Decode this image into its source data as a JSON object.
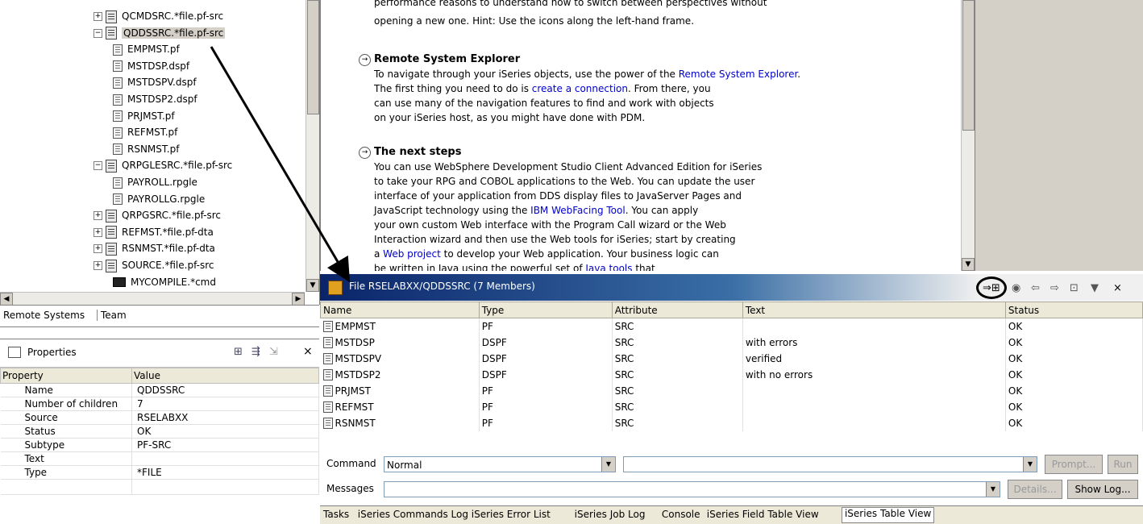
{
  "tree": {
    "nodes": [
      {
        "label": "QCMDSRC.*file.pf-src",
        "toggle": "+",
        "kind": "lib"
      },
      {
        "label": "QDDSSRC.*file.pf-src",
        "toggle": "−",
        "kind": "lib"
      },
      {
        "label": "EMPMST.pf",
        "kind": "mem"
      },
      {
        "label": "MSTDSP.dspf",
        "kind": "mem"
      },
      {
        "label": "MSTDSPV.dspf",
        "kind": "mem"
      },
      {
        "label": "MSTDSP2.dspf",
        "kind": "mem"
      },
      {
        "label": "PRJMST.pf",
        "kind": "mem"
      },
      {
        "label": "REFMST.pf",
        "kind": "mem"
      },
      {
        "label": "RSNMST.pf",
        "kind": "mem"
      },
      {
        "label": "QRPGLESRC.*file.pf-src",
        "toggle": "−",
        "kind": "lib"
      },
      {
        "label": "PAYROLL.rpgle",
        "kind": "mem"
      },
      {
        "label": "PAYROLLG.rpgle",
        "kind": "mem"
      },
      {
        "label": "QRPGSRC.*file.pf-src",
        "toggle": "+",
        "kind": "lib"
      },
      {
        "label": "REFMST.*file.pf-dta",
        "toggle": "+",
        "kind": "lib"
      },
      {
        "label": "RSNMST.*file.pf-dta",
        "toggle": "+",
        "kind": "lib"
      },
      {
        "label": "SOURCE.*file.pf-src",
        "toggle": "+",
        "kind": "lib"
      },
      {
        "label": "MYCOMPILE.*cmd",
        "kind": "cmd"
      }
    ]
  },
  "view_tabs": {
    "remote_systems": "Remote Systems",
    "team": "Team"
  },
  "properties": {
    "title": "Properties",
    "col_property": "Property",
    "col_value": "Value",
    "rows": [
      {
        "p": "Name",
        "v": "QDDSSRC"
      },
      {
        "p": "Number of children",
        "v": "7"
      },
      {
        "p": "Source",
        "v": "RSELABXX"
      },
      {
        "p": "Status",
        "v": "OK"
      },
      {
        "p": "Subtype",
        "v": "PF-SRC"
      },
      {
        "p": "Text",
        "v": ""
      },
      {
        "p": "Type",
        "v": "*FILE"
      }
    ]
  },
  "welcome": {
    "top_line1": "performance reasons to understand how to switch between perspectives without",
    "top_line2": "opening a new one. Hint: Use the icons along the left-hand frame.",
    "rse_title": "Remote System Explorer",
    "rse_l1a": "To navigate through your iSeries objects, use the power of the ",
    "rse_l1_link": "Remote System Explorer",
    "rse_l1b": ".",
    "rse_l2a": "The first thing you need to do is ",
    "rse_l2_link": "create a connection",
    "rse_l2b": ". From there, you",
    "rse_l3": "can use many of the navigation features to find and work with objects",
    "rse_l4": "on your iSeries host, as you might have done with PDM.",
    "next_title": "The next steps",
    "n1": "You can use WebSphere Development Studio Client Advanced Edition for iSeries",
    "n2": "to take your RPG and COBOL applications to the Web. You can update the user",
    "n3": "interface of your application from DDS display files to JavaServer Pages and",
    "n4a": "JavaScript technology using the ",
    "n4_link": "IBM WebFacing Tool",
    "n4b": ". You can apply",
    "n5": "your own custom Web interface with the Program Call wizard or the Web",
    "n6": "Interaction wizard and then use the Web tools for iSeries; start by creating",
    "n7a": "a ",
    "n7_link": "Web project",
    "n7b": " to develop your Web application. Your business logic can",
    "n8a": "be written in Java using the powerful set of ",
    "n8_link": "Java tools",
    "n8b": " that"
  },
  "table_view": {
    "title": "File RSELABXX/QDDSSRC (7 Members)",
    "columns": [
      "Name",
      "Type",
      "Attribute",
      "Text",
      "Status"
    ],
    "rows": [
      [
        "EMPMST",
        "PF",
        "SRC",
        "",
        "OK"
      ],
      [
        "MSTDSP",
        "DSPF",
        "SRC",
        "with errors",
        "OK"
      ],
      [
        "MSTDSPV",
        "DSPF",
        "SRC",
        "verified",
        "OK"
      ],
      [
        "MSTDSP2",
        "DSPF",
        "SRC",
        "with no errors",
        "OK"
      ],
      [
        "PRJMST",
        "PF",
        "SRC",
        "",
        "OK"
      ],
      [
        "REFMST",
        "PF",
        "SRC",
        "",
        "OK"
      ],
      [
        "RSNMST",
        "PF",
        "SRC",
        "",
        "OK"
      ]
    ]
  },
  "command": {
    "label": "Command",
    "value": "Normal",
    "prompt": "Prompt...",
    "run": "Run"
  },
  "messages": {
    "label": "Messages",
    "details": "Details...",
    "show_log": "Show Log..."
  },
  "bottom_tabs": [
    "Tasks",
    "iSeries Commands Log",
    "iSeries Error List",
    "iSeries Job Log",
    "Console",
    "iSeries Field Table View",
    "iSeries Table View"
  ]
}
